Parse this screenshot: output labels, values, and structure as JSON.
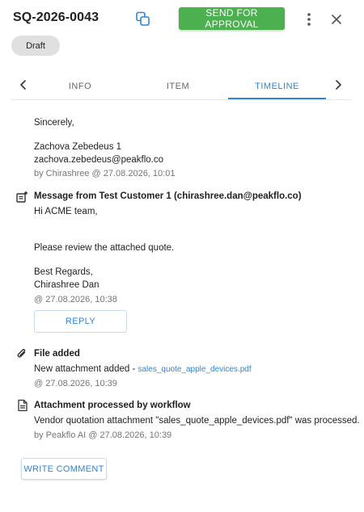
{
  "header": {
    "doc_id": "SQ-2026-0043",
    "send_label": "SEND FOR APPROVAL",
    "status": "Draft",
    "copy_icon": "copy-icon",
    "more_icon": "more-vertical-icon",
    "close_icon": "close-icon"
  },
  "tabs": {
    "items": [
      {
        "label": "INFO"
      },
      {
        "label": "ITEM"
      },
      {
        "label": "TIMELINE"
      }
    ],
    "active": "TIMELINE"
  },
  "timeline": {
    "email_tail": {
      "closing": "Sincerely,",
      "sender_name": "Zachova Zebedeus 1",
      "sender_email": "zachova.zebedeus@peakflo.co",
      "meta": "by Chirashree @ 27.08.2026, 10:01"
    },
    "message": {
      "icon": "note-add-icon",
      "title": "Message from Test Customer 1 (chirashree.dan@peakflo.co)",
      "greeting": "Hi ACME team,",
      "body": "Please review the attached quote.",
      "signoff": "Best Regards,",
      "signer": "Chirashree Dan",
      "meta": "@ 27.08.2026, 10:38",
      "reply_label": "REPLY"
    },
    "file_added": {
      "icon": "paperclip-icon",
      "title": "File added",
      "text": "New attachment added - ",
      "file": "sales_quote_apple_devices.pdf",
      "meta": "@ 27.08.2026, 10:39"
    },
    "processed": {
      "icon": "document-icon",
      "title": "Attachment processed by workflow",
      "text": "Vendor quotation attachment \"sales_quote_apple_devices.pdf\" was processed.",
      "meta": "by Peakflo AI @ 27.08.2026, 10:39"
    }
  },
  "footer": {
    "write_comment_label": "WRITE COMMENT"
  },
  "colors": {
    "accent": "#2c86d6",
    "primary_button": "#4caf50",
    "chip_bg": "#e0e0e0"
  }
}
